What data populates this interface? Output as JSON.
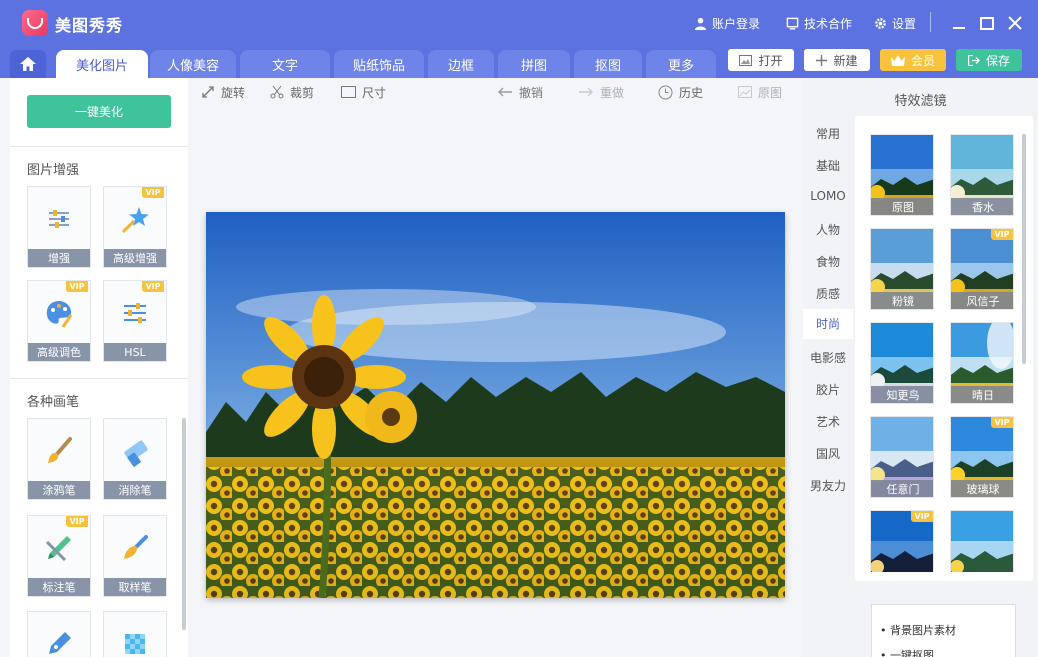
{
  "app": {
    "title": "美图秀秀"
  },
  "titlebar": {
    "login": "账户登录",
    "cooperation": "技术合作",
    "settings": "设置"
  },
  "tabs": [
    {
      "label": "美化图片",
      "active": true
    },
    {
      "label": "人像美容"
    },
    {
      "label": "文字"
    },
    {
      "label": "贴纸饰品"
    },
    {
      "label": "边框"
    },
    {
      "label": "拼图"
    },
    {
      "label": "抠图"
    },
    {
      "label": "更多"
    }
  ],
  "actions": {
    "open": "打开",
    "new": "新建",
    "vip": "会员",
    "save": "保存"
  },
  "left": {
    "one_click": "一键美化",
    "section_enhance": "图片增强",
    "enhance_tools": [
      {
        "label": "增强",
        "icon": "adjust-sliders-icon",
        "vip": false
      },
      {
        "label": "高级增强",
        "icon": "magic-star-icon",
        "vip": true
      },
      {
        "label": "高级调色",
        "icon": "palette-icon",
        "vip": true
      },
      {
        "label": "HSL",
        "icon": "hsl-sliders-icon",
        "vip": true
      }
    ],
    "section_brushes": "各种画笔",
    "brush_tools": [
      {
        "label": "涂鸦笔",
        "icon": "paint-brush-icon",
        "vip": false
      },
      {
        "label": "消除笔",
        "icon": "eraser-icon",
        "vip": false
      },
      {
        "label": "标注笔",
        "icon": "marker-pen-icon",
        "vip": true
      },
      {
        "label": "取样笔",
        "icon": "sampling-brush-icon",
        "vip": false
      },
      {
        "label": "",
        "icon": "fountain-pen-icon",
        "vip": false
      },
      {
        "label": "",
        "icon": "mosaic-icon",
        "vip": false
      }
    ],
    "vip_badge": "VIP"
  },
  "toolbar": {
    "rotate": "旋转",
    "crop": "裁剪",
    "resize": "尺寸",
    "undo": "撤销",
    "redo": "重做",
    "history": "历史",
    "original": "原图"
  },
  "right": {
    "title": "特效滤镜",
    "categories": [
      "常用",
      "基础",
      "LOMO",
      "人物",
      "食物",
      "质感",
      "时尚",
      "电影感",
      "胶片",
      "艺术",
      "国风",
      "男友力"
    ],
    "active_category": "时尚",
    "filters": [
      {
        "label": "原图",
        "vip": false
      },
      {
        "label": "香水",
        "vip": false
      },
      {
        "label": "粉镜",
        "vip": false
      },
      {
        "label": "风信子",
        "vip": true
      },
      {
        "label": "知更鸟",
        "vip": false
      },
      {
        "label": "晴日",
        "vip": false
      },
      {
        "label": "任意门",
        "vip": false
      },
      {
        "label": "玻璃球",
        "vip": true
      },
      {
        "label": "",
        "vip": true
      },
      {
        "label": "",
        "vip": false
      }
    ],
    "bottom_items": [
      "背景图片素材",
      "一键抠图"
    ]
  },
  "colors": {
    "brand": "#5b72e0",
    "accent_green": "#3fc39b",
    "vip_gold": "#f9c23c"
  }
}
